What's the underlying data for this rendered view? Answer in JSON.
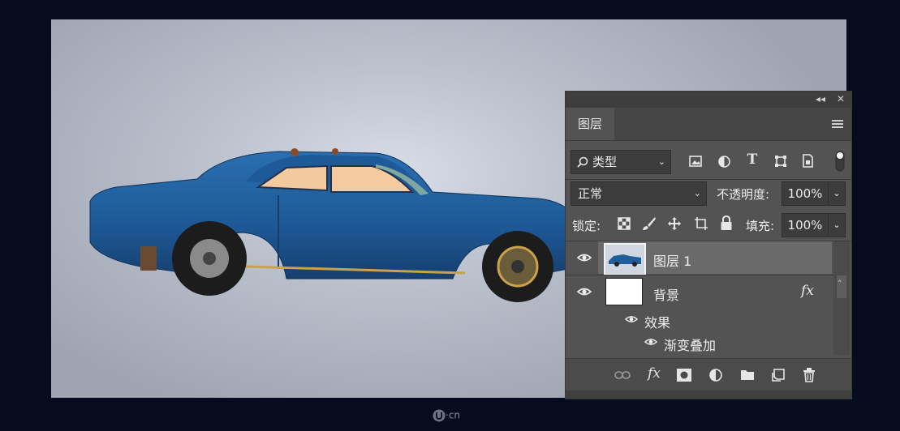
{
  "panel": {
    "tab_label": "图层",
    "filter": {
      "label": "类型"
    },
    "blend_mode": "正常",
    "opacity": {
      "label": "不透明度:",
      "value": "100%"
    },
    "lock": {
      "label": "锁定:"
    },
    "fill": {
      "label": "填充:",
      "value": "100%"
    },
    "layers": [
      {
        "name": "图层 1",
        "selected": true
      },
      {
        "name": "背景",
        "fx": "fx"
      }
    ],
    "effects": {
      "label": "效果",
      "items": [
        "渐变叠加"
      ]
    },
    "bottom_fx": "fx"
  },
  "watermark": "·cn",
  "icons": [
    "collapse-icon",
    "close-icon",
    "panel-menu-icon",
    "search-icon",
    "image-filter-icon",
    "adjustment-filter-icon",
    "type-filter-icon",
    "shape-filter-icon",
    "smart-object-filter-icon",
    "filter-toggle-icon",
    "lock-pixels-icon",
    "lock-brush-icon",
    "lock-move-icon",
    "lock-artboard-icon",
    "lock-all-icon",
    "eye-icon",
    "link-icon",
    "mask-icon",
    "adjustment-icon",
    "folder-icon",
    "new-layer-icon",
    "trash-icon"
  ],
  "colors": {
    "panel_bg": "#535353",
    "selected_layer": "#6a6a6a",
    "canvas_bg": "#060b1d",
    "car_blue": "#1f5e9c"
  }
}
